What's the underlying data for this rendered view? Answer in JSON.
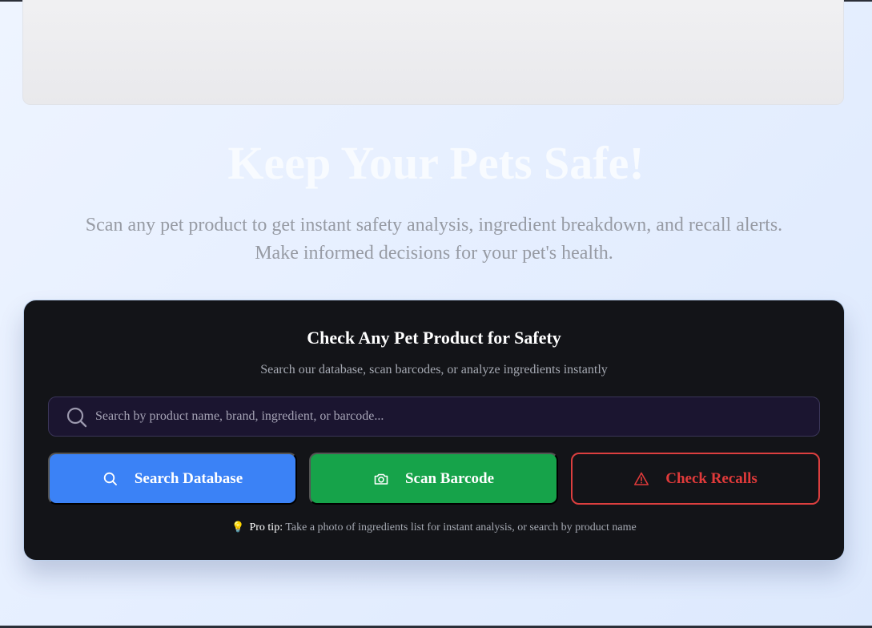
{
  "hero": {
    "title": "Keep Your Pets Safe!",
    "subtitle": "Scan any pet product to get instant safety analysis, ingredient breakdown, and recall alerts. Make informed decisions for your pet's health."
  },
  "panel": {
    "title": "Check Any Pet Product for Safety",
    "subtitle": "Search our database, scan barcodes, or analyze ingredients instantly",
    "search": {
      "placeholder": "Search by product name, brand, ingredient, or barcode...",
      "value": "",
      "icon": "search-icon"
    },
    "buttons": {
      "search_label": "Search Database",
      "search_icon": "search-icon",
      "scan_label": "Scan Barcode",
      "scan_icon": "camera-icon",
      "recall_label": "Check Recalls",
      "recall_icon": "warning-icon"
    },
    "tip": {
      "icon": "lightbulb-icon",
      "bulb": "💡",
      "label": "Pro tip:",
      "text": " Take a photo of ingredients list for instant analysis, or search by product name"
    }
  },
  "colors": {
    "primary_blue": "#3b82f6",
    "success_green": "#16a34a",
    "danger_red": "#dc3f3f",
    "panel_bg": "#131418"
  }
}
